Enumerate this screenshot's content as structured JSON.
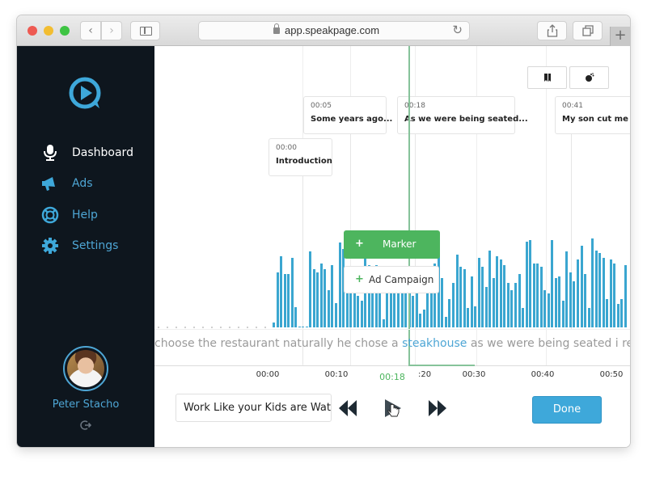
{
  "browser": {
    "url": "app.speakpage.com",
    "back_icon": "chevron-left-icon",
    "forward_icon": "chevron-right-icon"
  },
  "sidebar": {
    "items": [
      {
        "label": "Dashboard",
        "icon": "microphone-icon",
        "active": true
      },
      {
        "label": "Ads",
        "icon": "megaphone-icon",
        "active": false
      },
      {
        "label": "Help",
        "icon": "lifebuoy-icon",
        "active": false
      },
      {
        "label": "Settings",
        "icon": "gear-icon",
        "active": false
      }
    ],
    "user": {
      "name": "Peter Stacho"
    }
  },
  "colors": {
    "accent": "#4ea6d5",
    "sidebar_bg": "#0e161e",
    "waveform": "#3aa6d0",
    "green": "#4db55e",
    "done": "#3ea8da"
  },
  "markers": [
    {
      "time": "00:00",
      "title": "Introduction"
    },
    {
      "time": "00:05",
      "title": "Some years ago..."
    },
    {
      "time": "00:18",
      "title": "As we were being seated..."
    },
    {
      "time": "00:41",
      "title": "My son cut me of"
    }
  ],
  "popup": {
    "marker_label": "Marker",
    "ad_campaign_label": "Ad Campaign"
  },
  "transcript": {
    "before": "choose the restaurant naturally he chose a ",
    "highlight": "steakhouse",
    "after": " as we were being seated i reco"
  },
  "timeline": {
    "ticks": [
      "00:00",
      "00:10",
      ":20",
      "00:30",
      "00:40",
      "00:50"
    ],
    "current_time": "00:18"
  },
  "waveform": {
    "levels": [
      0.05,
      0.62,
      0.8,
      0.6,
      0.6,
      0.78,
      0.23,
      0,
      0,
      0,
      0.85,
      0.65,
      0.62,
      0.72,
      0.65,
      0.42,
      0.7,
      0.27,
      0.95,
      0.88,
      0.5,
      0.5,
      0.5,
      0.35,
      0.3,
      0.9,
      0.7,
      0.66,
      0.7,
      0.4,
      0.09,
      0.52,
      0.6,
      0.5,
      0.65,
      0.6,
      0.6,
      0.55,
      0.35,
      0.45,
      0.15,
      0.2,
      0.42,
      0.65,
      0.72,
      0.95,
      0.55,
      0.12,
      0.32,
      0.5,
      0.82,
      0.68,
      0.65,
      0.22,
      0.57,
      0.24,
      0.78,
      0.68,
      0.45,
      0.86,
      0.55,
      0.8,
      0.76,
      0.7,
      0.5,
      0.42,
      0.5,
      0.6,
      0.22,
      0.96,
      0.98,
      0.72,
      0.72,
      0.68,
      0.42,
      0.38,
      0.98,
      0.55,
      0.57,
      0.3,
      0.85,
      0.62,
      0.52,
      0.76,
      0.92,
      0.6,
      0.22,
      1,
      0.86,
      0.84,
      0.78,
      0.32,
      0.76,
      0.72,
      0.26,
      0.32,
      0.7
    ]
  },
  "footer": {
    "title_value": "Work Like your Kids are Watc",
    "done_label": "Done"
  },
  "toolbar": {
    "view_buttons": [
      "bookmark-icon",
      "mouse-icon"
    ]
  }
}
